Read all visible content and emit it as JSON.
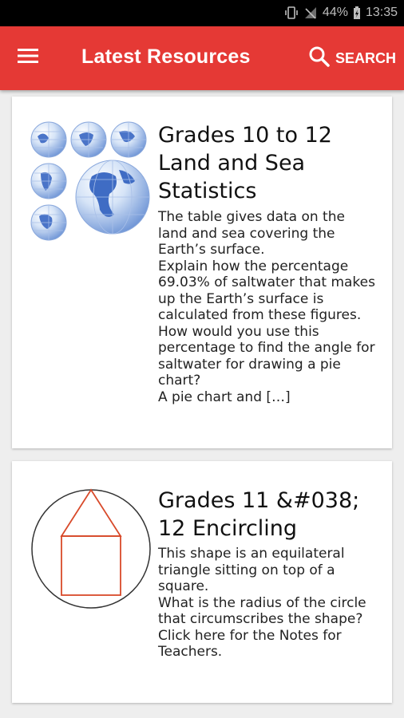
{
  "status_bar": {
    "battery": "44%",
    "time": "13:35"
  },
  "app_bar": {
    "title": "Latest Resources",
    "search_label": "SEARCH",
    "color": "#e53935"
  },
  "resources": [
    {
      "title": "Grades 10 to 12 Land and Sea Statistics",
      "excerpt": "The table gives data on the land and sea covering the Earth’s surface.\nExplain how the percentage 69.03% of saltwater that makes up the Earth’s surface is calculated from these figures.\nHow would you use this percentage to find the angle for saltwater for drawing a pie chart?\nA pie chart and […]",
      "thumbnail": "globes-thumbnail"
    },
    {
      "title": "Grades 11 &#038; 12 Encircling",
      "excerpt": "This shape is an equilateral triangle sitting on top of a square.\nWhat is the radius of the circle that circumscribes the shape?\nClick here for the Notes for Teachers.",
      "thumbnail": "circle-house-thumbnail"
    }
  ]
}
